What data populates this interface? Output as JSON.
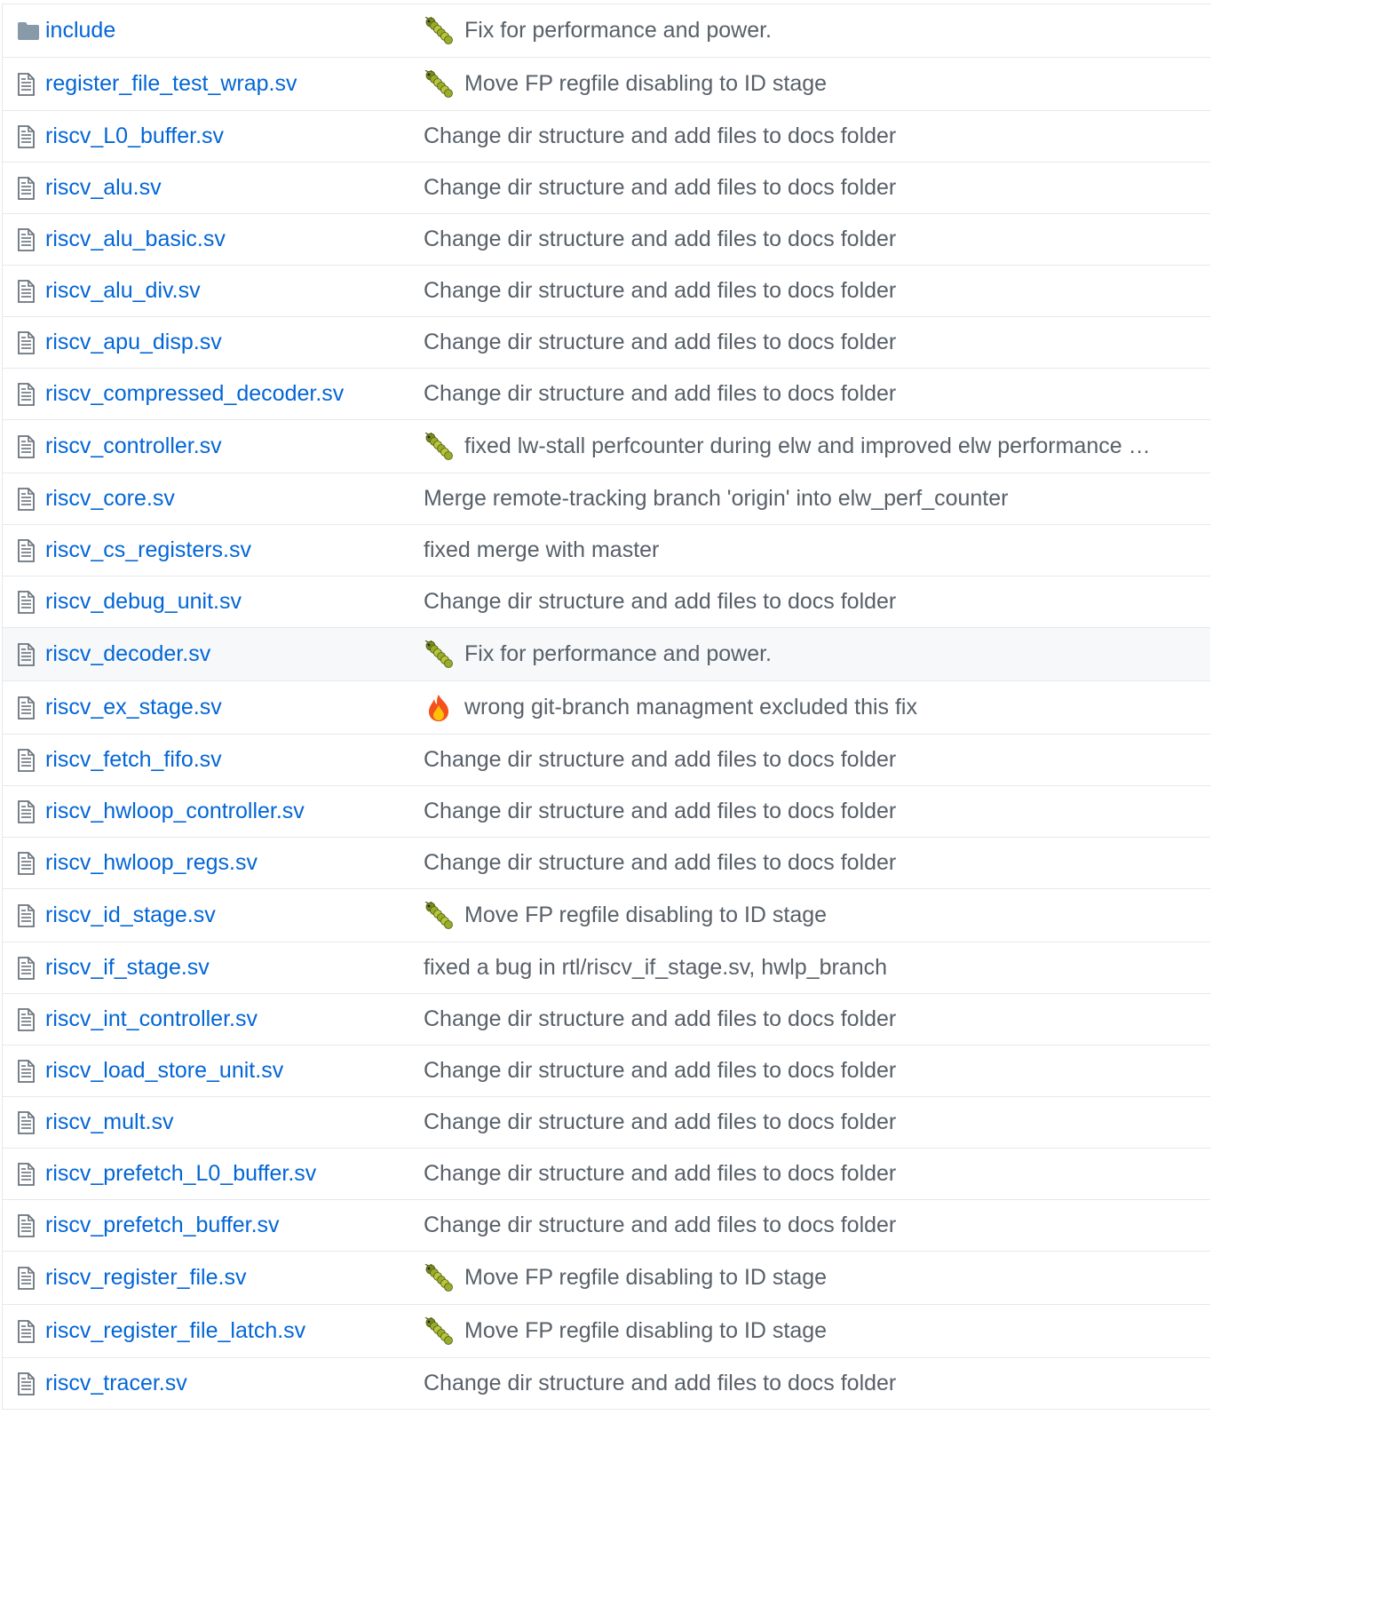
{
  "colors": {
    "link": "#0366d6",
    "message": "#586069",
    "border": "#e6e9ec",
    "icon": "#6a737d",
    "hover_row": "#f6f8fa"
  },
  "files": [
    {
      "name": "include",
      "type": "directory",
      "icon": "folder-icon",
      "emoji": "caterpillar-emoji",
      "message": "Fix for performance and power."
    },
    {
      "name": "register_file_test_wrap.sv",
      "type": "file",
      "icon": "file-icon",
      "emoji": "caterpillar-emoji",
      "message": "Move FP regfile disabling to ID stage"
    },
    {
      "name": "riscv_L0_buffer.sv",
      "type": "file",
      "icon": "file-icon",
      "emoji": "",
      "message": "Change dir structure and add files to docs folder"
    },
    {
      "name": "riscv_alu.sv",
      "type": "file",
      "icon": "file-icon",
      "emoji": "",
      "message": "Change dir structure and add files to docs folder"
    },
    {
      "name": "riscv_alu_basic.sv",
      "type": "file",
      "icon": "file-icon",
      "emoji": "",
      "message": "Change dir structure and add files to docs folder"
    },
    {
      "name": "riscv_alu_div.sv",
      "type": "file",
      "icon": "file-icon",
      "emoji": "",
      "message": "Change dir structure and add files to docs folder"
    },
    {
      "name": "riscv_apu_disp.sv",
      "type": "file",
      "icon": "file-icon",
      "emoji": "",
      "message": "Change dir structure and add files to docs folder"
    },
    {
      "name": "riscv_compressed_decoder.sv",
      "type": "file",
      "icon": "file-icon",
      "emoji": "",
      "message": "Change dir structure and add files to docs folder"
    },
    {
      "name": "riscv_controller.sv",
      "type": "file",
      "icon": "file-icon",
      "emoji": "caterpillar-emoji",
      "message": "fixed lw-stall perfcounter during elw and improved elw performance …"
    },
    {
      "name": "riscv_core.sv",
      "type": "file",
      "icon": "file-icon",
      "emoji": "",
      "message": "Merge remote-tracking branch 'origin' into elw_perf_counter"
    },
    {
      "name": "riscv_cs_registers.sv",
      "type": "file",
      "icon": "file-icon",
      "emoji": "",
      "message": "fixed merge with master"
    },
    {
      "name": "riscv_debug_unit.sv",
      "type": "file",
      "icon": "file-icon",
      "emoji": "",
      "message": "Change dir structure and add files to docs folder"
    },
    {
      "name": "riscv_decoder.sv",
      "type": "file",
      "icon": "file-icon",
      "emoji": "caterpillar-emoji",
      "message": "Fix for performance and power.",
      "hover": true
    },
    {
      "name": "riscv_ex_stage.sv",
      "type": "file",
      "icon": "file-icon",
      "emoji": "fire-emoji",
      "message": "wrong git-branch managment excluded this fix"
    },
    {
      "name": "riscv_fetch_fifo.sv",
      "type": "file",
      "icon": "file-icon",
      "emoji": "",
      "message": "Change dir structure and add files to docs folder"
    },
    {
      "name": "riscv_hwloop_controller.sv",
      "type": "file",
      "icon": "file-icon",
      "emoji": "",
      "message": "Change dir structure and add files to docs folder"
    },
    {
      "name": "riscv_hwloop_regs.sv",
      "type": "file",
      "icon": "file-icon",
      "emoji": "",
      "message": "Change dir structure and add files to docs folder"
    },
    {
      "name": "riscv_id_stage.sv",
      "type": "file",
      "icon": "file-icon",
      "emoji": "caterpillar-emoji",
      "message": "Move FP regfile disabling to ID stage"
    },
    {
      "name": "riscv_if_stage.sv",
      "type": "file",
      "icon": "file-icon",
      "emoji": "",
      "message": "fixed a bug in rtl/riscv_if_stage.sv, hwlp_branch"
    },
    {
      "name": "riscv_int_controller.sv",
      "type": "file",
      "icon": "file-icon",
      "emoji": "",
      "message": "Change dir structure and add files to docs folder"
    },
    {
      "name": "riscv_load_store_unit.sv",
      "type": "file",
      "icon": "file-icon",
      "emoji": "",
      "message": "Change dir structure and add files to docs folder"
    },
    {
      "name": "riscv_mult.sv",
      "type": "file",
      "icon": "file-icon",
      "emoji": "",
      "message": "Change dir structure and add files to docs folder"
    },
    {
      "name": "riscv_prefetch_L0_buffer.sv",
      "type": "file",
      "icon": "file-icon",
      "emoji": "",
      "message": "Change dir structure and add files to docs folder"
    },
    {
      "name": "riscv_prefetch_buffer.sv",
      "type": "file",
      "icon": "file-icon",
      "emoji": "",
      "message": "Change dir structure and add files to docs folder"
    },
    {
      "name": "riscv_register_file.sv",
      "type": "file",
      "icon": "file-icon",
      "emoji": "caterpillar-emoji",
      "message": "Move FP regfile disabling to ID stage"
    },
    {
      "name": "riscv_register_file_latch.sv",
      "type": "file",
      "icon": "file-icon",
      "emoji": "caterpillar-emoji",
      "message": "Move FP regfile disabling to ID stage"
    },
    {
      "name": "riscv_tracer.sv",
      "type": "file",
      "icon": "file-icon",
      "emoji": "",
      "message": "Change dir structure and add files to docs folder"
    }
  ]
}
